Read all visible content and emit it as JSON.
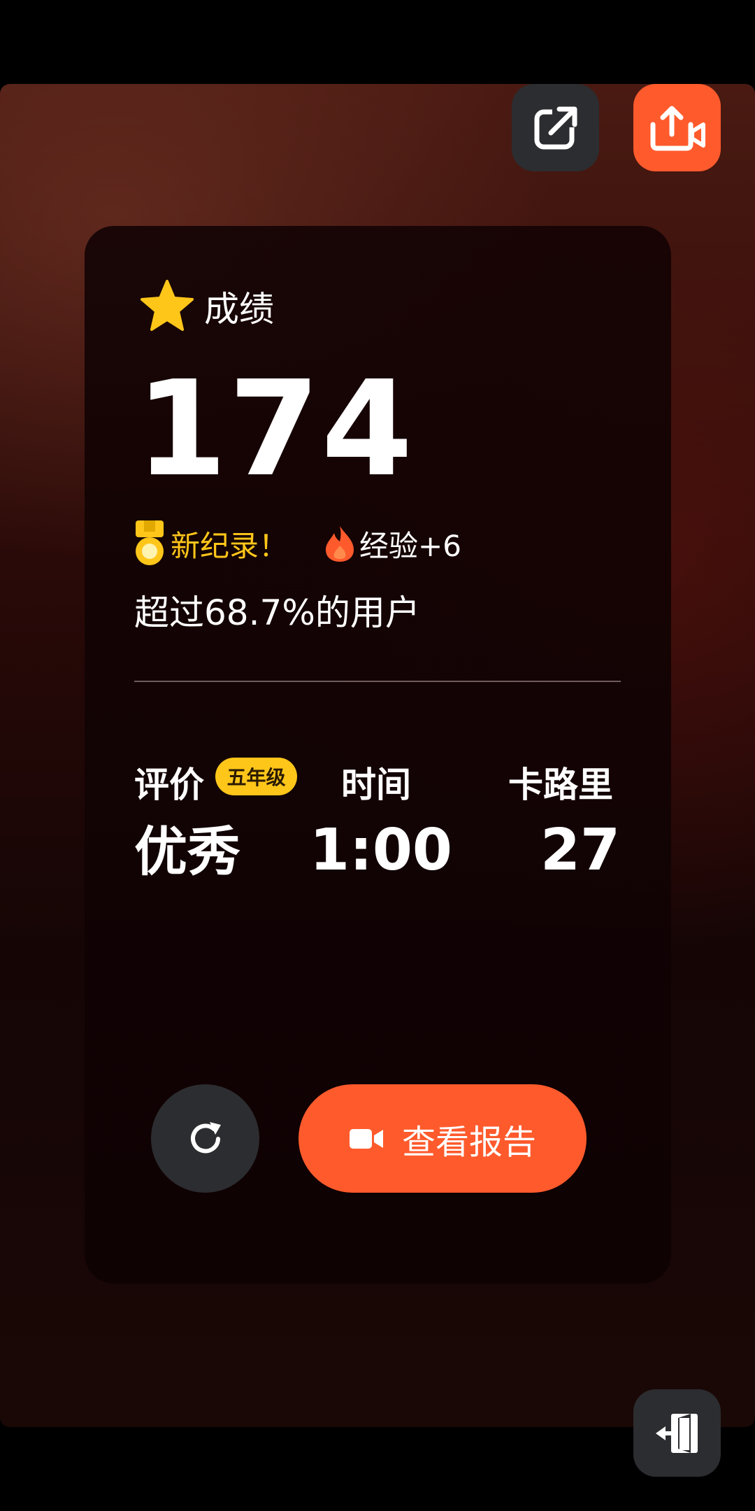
{
  "toolbar": {
    "share_icon": "external-share-icon",
    "export_icon": "upload-video-icon",
    "accent": "#ff5a2c"
  },
  "result": {
    "title": "成绩",
    "title_icon": "star-icon",
    "score": "174",
    "record_label": "新纪录！",
    "record_icon": "medal-icon",
    "xp_label": "经验+6",
    "xp_icon": "flame-icon",
    "surpass_text": "超过68.7%的用户"
  },
  "stats": {
    "rating_label": "评价",
    "grade_badge": "五年级",
    "time_label": "时间",
    "calories_label": "卡路里",
    "rating_value": "优秀",
    "time_value": "1:00",
    "calories_value": "27"
  },
  "actions": {
    "replay_icon": "refresh-icon",
    "report_label": "查看报告",
    "report_icon": "video-camera-icon",
    "exit_icon": "exit-door-icon"
  },
  "colors": {
    "gold": "#ffc61a",
    "flame": "#ff5a2c",
    "button_dark": "#2c2d30"
  }
}
